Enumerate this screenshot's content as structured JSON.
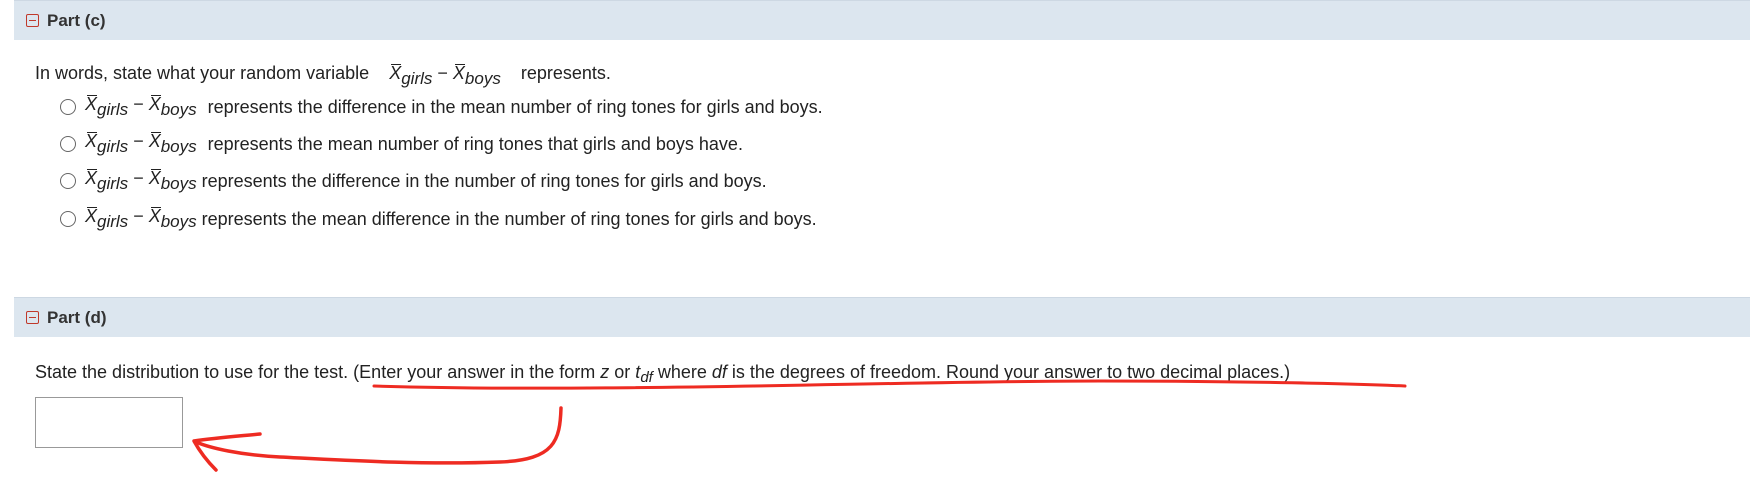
{
  "part_c": {
    "title": "Part (c)",
    "question_prefix": "In words, state what your random variable",
    "question_suffix": "represents.",
    "var_x": "X",
    "sub_girls": "girls",
    "sub_boys": "boys",
    "minus": "−",
    "options": [
      {
        "text": "represents the difference in the mean number of ring tones for girls and boys."
      },
      {
        "text": "represents the mean number of ring tones that girls and boys have."
      },
      {
        "text": "represents the difference in the number of ring tones for girls and boys."
      },
      {
        "text": "represents the mean difference in the number of ring tones for girls and boys."
      }
    ]
  },
  "part_d": {
    "title": "Part (d)",
    "question_a": "State the distribution to use for the test. (Enter your answer in the form ",
    "z": "z",
    "or": " or ",
    "t": "t",
    "df_sub": "df",
    "question_b": " where ",
    "df": "df",
    "question_c": " is the degrees of freedom. Round your answer to two decimal places.)",
    "answer_value": ""
  },
  "annotation_color": "#ee2b22"
}
